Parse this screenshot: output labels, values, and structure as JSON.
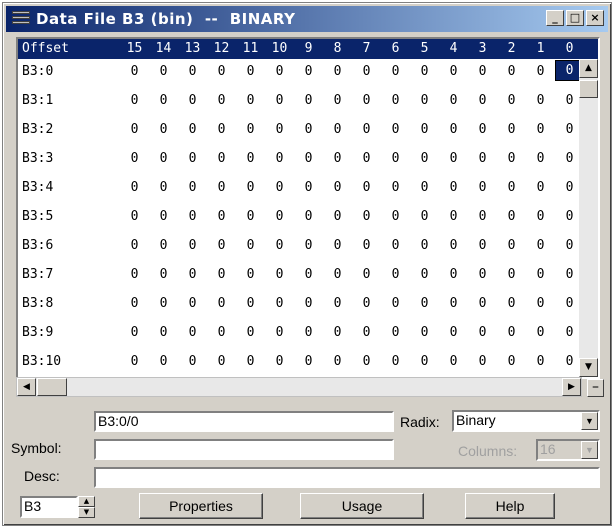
{
  "window": {
    "title": "Data File B3 (bin)  --  BINARY"
  },
  "grid": {
    "offset_header": "Offset",
    "bit_headers": [
      "15",
      "14",
      "13",
      "12",
      "11",
      "10",
      "9",
      "8",
      "7",
      "6",
      "5",
      "4",
      "3",
      "2",
      "1",
      "0"
    ],
    "rows": [
      {
        "label": "B3:0",
        "bits": [
          "0",
          "0",
          "0",
          "0",
          "0",
          "0",
          "0",
          "0",
          "0",
          "0",
          "0",
          "0",
          "0",
          "0",
          "0",
          "0"
        ]
      },
      {
        "label": "B3:1",
        "bits": [
          "0",
          "0",
          "0",
          "0",
          "0",
          "0",
          "0",
          "0",
          "0",
          "0",
          "0",
          "0",
          "0",
          "0",
          "0",
          "0"
        ]
      },
      {
        "label": "B3:2",
        "bits": [
          "0",
          "0",
          "0",
          "0",
          "0",
          "0",
          "0",
          "0",
          "0",
          "0",
          "0",
          "0",
          "0",
          "0",
          "0",
          "0"
        ]
      },
      {
        "label": "B3:3",
        "bits": [
          "0",
          "0",
          "0",
          "0",
          "0",
          "0",
          "0",
          "0",
          "0",
          "0",
          "0",
          "0",
          "0",
          "0",
          "0",
          "0"
        ]
      },
      {
        "label": "B3:4",
        "bits": [
          "0",
          "0",
          "0",
          "0",
          "0",
          "0",
          "0",
          "0",
          "0",
          "0",
          "0",
          "0",
          "0",
          "0",
          "0",
          "0"
        ]
      },
      {
        "label": "B3:5",
        "bits": [
          "0",
          "0",
          "0",
          "0",
          "0",
          "0",
          "0",
          "0",
          "0",
          "0",
          "0",
          "0",
          "0",
          "0",
          "0",
          "0"
        ]
      },
      {
        "label": "B3:6",
        "bits": [
          "0",
          "0",
          "0",
          "0",
          "0",
          "0",
          "0",
          "0",
          "0",
          "0",
          "0",
          "0",
          "0",
          "0",
          "0",
          "0"
        ]
      },
      {
        "label": "B3:7",
        "bits": [
          "0",
          "0",
          "0",
          "0",
          "0",
          "0",
          "0",
          "0",
          "0",
          "0",
          "0",
          "0",
          "0",
          "0",
          "0",
          "0"
        ]
      },
      {
        "label": "B3:8",
        "bits": [
          "0",
          "0",
          "0",
          "0",
          "0",
          "0",
          "0",
          "0",
          "0",
          "0",
          "0",
          "0",
          "0",
          "0",
          "0",
          "0"
        ]
      },
      {
        "label": "B3:9",
        "bits": [
          "0",
          "0",
          "0",
          "0",
          "0",
          "0",
          "0",
          "0",
          "0",
          "0",
          "0",
          "0",
          "0",
          "0",
          "0",
          "0"
        ]
      },
      {
        "label": "B3:10",
        "bits": [
          "0",
          "0",
          "0",
          "0",
          "0",
          "0",
          "0",
          "0",
          "0",
          "0",
          "0",
          "0",
          "0",
          "0",
          "0",
          "0"
        ]
      }
    ],
    "selected_cell": "B3:0/0"
  },
  "form": {
    "address_value": "B3:0/0",
    "radix_label": "Radix:",
    "radix_value": "Binary",
    "symbol_label": "Symbol:",
    "symbol_value": "",
    "columns_label": "Columns:",
    "columns_value": "16",
    "desc_label": "Desc:",
    "desc_value": "",
    "file_value": "B3"
  },
  "buttons": {
    "properties": "Properties",
    "usage": "Usage",
    "help": "Help"
  },
  "icons": {
    "window": "data-file-icon",
    "minimize": "minimize-icon",
    "maximize": "maximize-icon",
    "close": "close-icon"
  }
}
